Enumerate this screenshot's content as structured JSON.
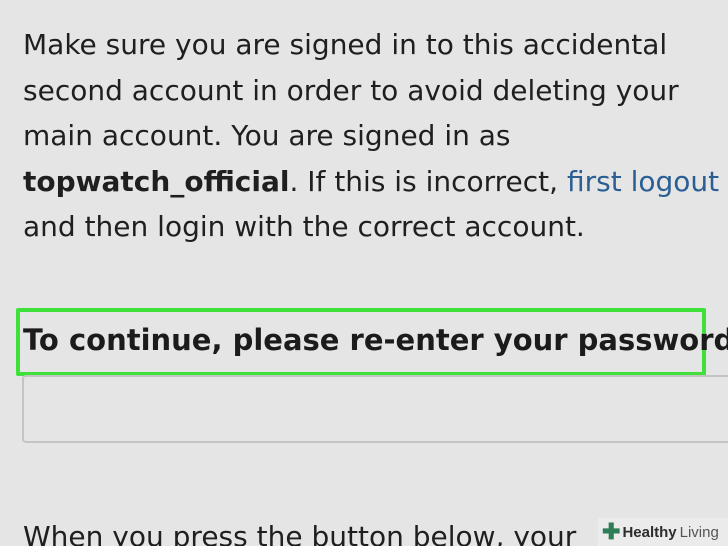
{
  "intro": {
    "line1": "Make sure you are signed in to this accidental",
    "line2": "second account in order to avoid deleting your",
    "line3": "main account. You are signed in as",
    "username": "topwatch_official",
    "line4_rest": ". If this is incorrect, ",
    "logout_link": "first logout",
    "line5": "and then login with the correct account."
  },
  "password_section": {
    "label": "To continue, please re-enter your password",
    "input_value": "",
    "highlight_color": "#3de13a"
  },
  "footer": {
    "text": "When you press the button below, your"
  },
  "watermark": {
    "brand_bold": "Healthy",
    "brand_light": "Living",
    "icon": "plus-cross-icon"
  },
  "colors": {
    "background": "#e5e5e5",
    "link": "#2b5f94",
    "text": "#1f1f1f"
  }
}
